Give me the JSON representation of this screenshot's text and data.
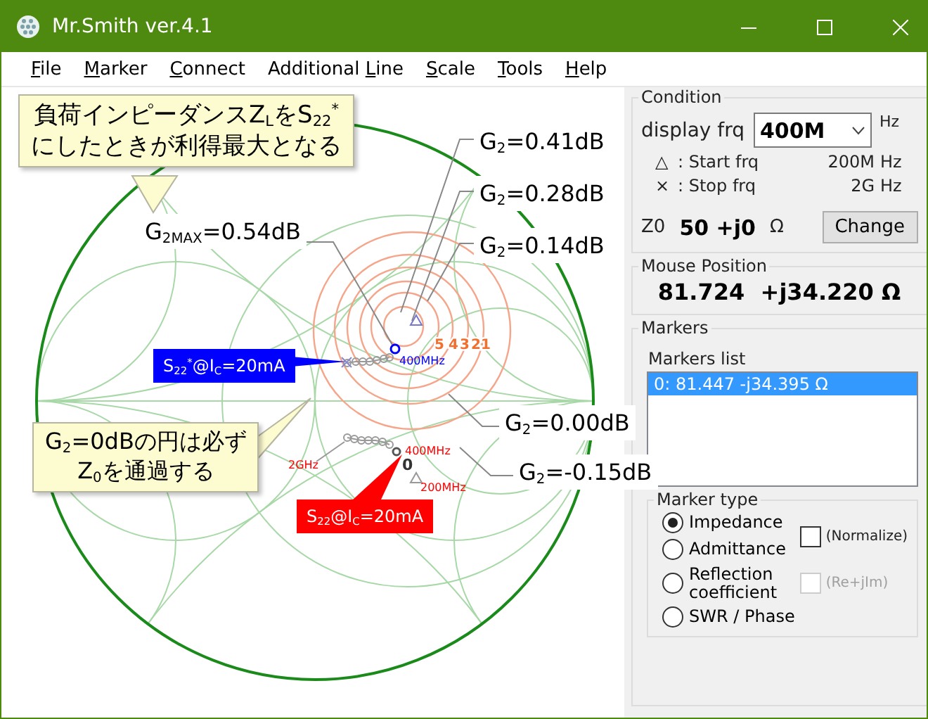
{
  "window": {
    "title": "Mr.Smith ver.4.1"
  },
  "menu": [
    {
      "key": "F",
      "post": "ile"
    },
    {
      "key": "M",
      "post": "arker"
    },
    {
      "key": "C",
      "post": "onnect"
    },
    {
      "pre": "Additional ",
      "key": "L",
      "post": "ine"
    },
    {
      "key": "S",
      "post": "cale"
    },
    {
      "key": "T",
      "post": "ools"
    },
    {
      "key": "H",
      "post": "elp"
    }
  ],
  "chart": {
    "callouts": [
      "負荷インピーダンスZ$_{L}$をS$_{22}$$^{*}$\nにしたときが利得最大となる",
      "G$_{2}$=0dBの円は必ず\nZ$_{0}$を通過する"
    ],
    "gain_labels": [
      "G$_{2MAX}$=0.54dB",
      "G$_{2}$=0.41dB",
      "G$_{2}$=0.28dB",
      "G$_{2}$=0.14dB",
      "G$_{2}$=0.00dB",
      "G$_{2}$=-0.15dB"
    ],
    "circle_numbers": [
      "5",
      "4",
      "3",
      "2",
      "1"
    ],
    "traces": [
      {
        "label": "S$_{22}$$^{*}$@I$_{C}$=20mA",
        "color": "#0000ff",
        "marker_label": "400MHz"
      },
      {
        "label": "S$_{22}$@I$_{C}$=20mA",
        "color": "#ff0000",
        "marker_label": "400MHz",
        "start_label": "200MHz",
        "stop_label": "2GHz",
        "marker_number": "0"
      }
    ]
  },
  "condition": {
    "title": "Condition",
    "display_label": "display frq",
    "display_value": "400M",
    "display_unit": "Hz",
    "start": {
      "symbol": "△",
      "label": ": Start frq",
      "value": "200M",
      "unit": "Hz"
    },
    "stop": {
      "symbol": "×",
      "label": ": Stop frq",
      "value": "2G",
      "unit": "Hz"
    },
    "z0_label": "Z0",
    "z0_value": "50 +j0",
    "z0_unit": "Ω",
    "change_button": "Change"
  },
  "mouse_position": {
    "title": "Mouse Position",
    "value": "81.724  +j34.220 Ω"
  },
  "markers": {
    "title": "Markers",
    "list_title": "Markers list",
    "items": [
      {
        "text": "0: 81.447 -j34.395 Ω",
        "selected": true
      }
    ],
    "marker_type": {
      "title": "Marker type",
      "options": [
        {
          "label": "Impedance",
          "selected": true
        },
        {
          "label": "Admittance",
          "selected": false
        },
        {
          "label": "Reflection\ncoefficient",
          "selected": false
        },
        {
          "label": "SWR / Phase",
          "selected": false
        }
      ],
      "checks": [
        {
          "label": "(Normalize)",
          "checked": false,
          "disabled": false
        },
        {
          "label": "(Re+jIm)",
          "checked": false,
          "disabled": true
        }
      ]
    }
  }
}
